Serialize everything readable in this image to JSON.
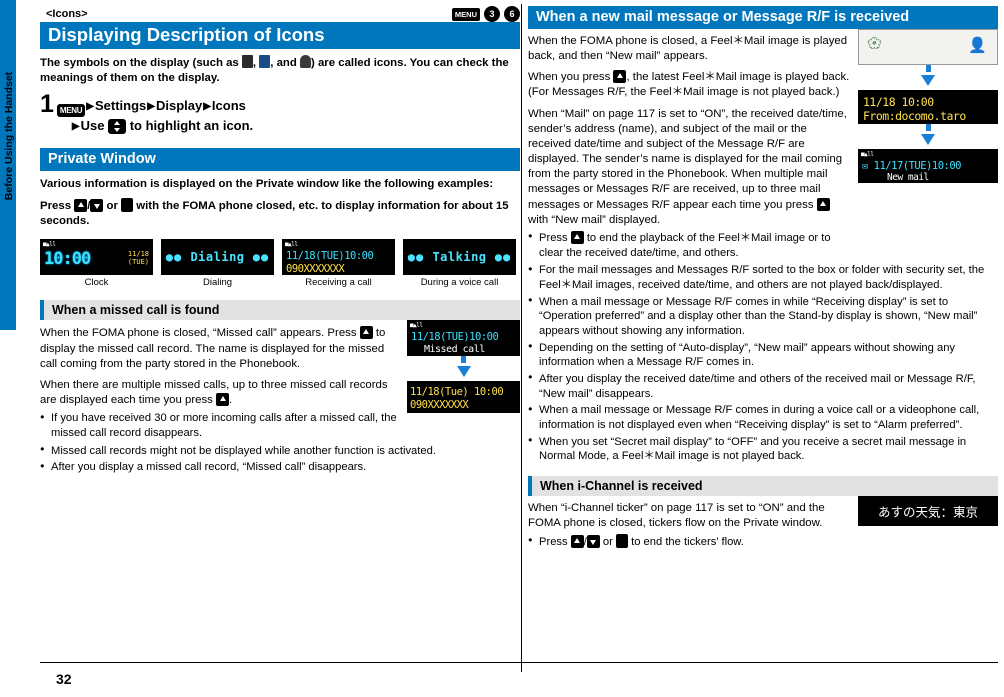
{
  "side_tab": {
    "label": "Before Using the Handset"
  },
  "page_number": "32",
  "left": {
    "kicker": "<Icons>",
    "title": "Displaying Description of Icons",
    "header_keys": [
      "MENU",
      "3",
      "6"
    ],
    "intro": "The symbols on the display (such as      ,      , and      ) are called icons. You can check the meanings of them on the display.",
    "step": {
      "number": "1",
      "line1_parts": [
        "Settings",
        "Display",
        "Icons"
      ],
      "line2": "Use          to highlight an icon."
    },
    "private_window": {
      "heading": "Private Window",
      "para1": "Various information is displayed on the Private window like the following examples:",
      "para2": "Press     /     or     with the FOMA phone closed, etc. to display information for about 15 seconds.",
      "figures": [
        {
          "caption": "Clock",
          "time": "10:00",
          "date": "11/18",
          "dow": "(TUE)"
        },
        {
          "caption": "Dialing",
          "text": "Dialing"
        },
        {
          "caption": "Receiving a call",
          "line1": "11/18(TUE)10:00",
          "line2": "090XXXXXXX"
        },
        {
          "caption": "During a voice call",
          "text": "Talking"
        }
      ]
    },
    "missed_call": {
      "heading": "When a missed call is found",
      "para1": "When the FOMA phone is closed, “Missed call” appears. Press     to display the missed call record. The name is displayed for the missed call coming from the party stored in the Phonebook.",
      "para2": "When there are multiple missed calls, up to three missed call records are displayed each time you press     .",
      "bullets": [
        "If you have received 30 or more incoming calls after a missed call, the missed call record disappears.",
        "Missed call records might not be displayed while another function is activated.",
        "After you display a missed call record, “Missed call” disappears."
      ],
      "fig1_l1": "11/18(TUE)10:00",
      "fig1_l2": "Missed call",
      "fig2_l1": "11/18(Tue) 10:00",
      "fig2_l2": "090XXXXXXX"
    }
  },
  "right": {
    "new_mail": {
      "heading": "When a new mail message or Message R/F is received",
      "para1": "When the FOMA phone is closed, a Feel＊Mail image is played back, and then “New mail” appears.",
      "para2": "When you press     , the latest Feel＊Mail image is played back. (For Messages R/F, the Feel＊Mail image is not played back.)",
      "para3": "When “Mail” on page 117 is set to “ON”, the received date/time, sender’s address (name), and subject of the mail or the received date/time and subject of the Message R/F are displayed. The sender’s name is displayed for the mail coming from the party stored in the Phonebook. When multiple mail messages or Messages R/F are received, up to three mail messages or Messages R/F appear each time you press     with “New mail” displayed.",
      "bullets": [
        "Press     to end the playback of the Feel＊Mail image or to clear the received date/time, and others.",
        "For the mail messages and Messages R/F sorted to the box or folder with security set, the Feel＊Mail images, received date/time, and others are not played back/displayed.",
        "When a mail message or Message R/F comes in while “Receiving display” is set to “Operation preferred” and a display other than the Stand-by display is shown, “New mail” appears without showing any information.",
        "Depending on the setting of “Auto-display”, “New mail” appears without showing any information when a Message R/F comes in.",
        "After you display the received date/time and others of the received mail or Message R/F, “New mail” disappears.",
        "When a mail message or Message R/F comes in during a voice call or a videophone call, information is not displayed even when “Receiving display” is set to “Alarm preferred”.",
        "When you set “Secret mail display” to “OFF” and you receive a secret mail message in Normal Mode, a Feel＊Mail image is not played back."
      ],
      "fig_mail_l1": "11/18 10:00",
      "fig_mail_l2": "From:docomo.taro",
      "fig_mail2_l1": "11/17(TUE)10:00",
      "fig_mail2_l2": "New mail"
    },
    "ichannel": {
      "heading": "When i-Channel is received",
      "para1": "When “i-Channel ticker” on page 117 is set to “ON” and the FOMA phone is closed, tickers flow on the Private window.",
      "bullets": [
        "Press     /     or     to end the tickers’ flow."
      ],
      "fig_text": "あすの天気：東京"
    }
  },
  "colors": {
    "accent": "#0076bd",
    "grey_bar": "#e2e2e2",
    "lcd_cyan": "#39e0ff",
    "lcd_yellow": "#ffe14d"
  }
}
